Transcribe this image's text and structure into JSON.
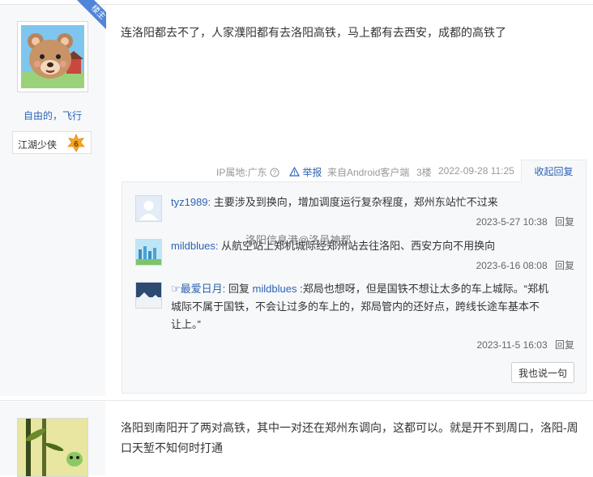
{
  "floor_post": {
    "corner_badge": "楼主",
    "author": {
      "name": "自由的，飞行",
      "level_title": "江湖少侠",
      "level_number": "6"
    },
    "content": "连洛阳都去不了，人家濮阳都有去洛阳高铁，马上都有去西安，成都的高铁了",
    "meta": {
      "ip_location": "IP属地:广东",
      "report": "举报",
      "source": "来自Android客户端",
      "floor": "3楼",
      "time": "2022-09-28 11:25"
    },
    "collapse_reply_label": "收起回复"
  },
  "replies": [
    {
      "user": "tyz1989:",
      "text": "主要涉及到换向，增加调度运行复杂程度，郑州东站忙不过来",
      "time": "2023-5-27 10:38",
      "reply_label": "回复"
    },
    {
      "user": "mildblues:",
      "text": "从航空站上郑机城际经郑州站去往洛阳、西安方向不用换向",
      "time": "2023-6-16 08:08",
      "reply_label": "回复"
    },
    {
      "user": "☞最爱日月:",
      "reply_prefix": "回复",
      "reply_to": "mildblues",
      "text_line1": ":郑局也想呀，但是国铁不想让太多的车上城际。“郑机",
      "text_line2": "城际不属于国铁，不会让过多的车上的，郑局管内的还好点，跨线长途车基本不",
      "text_line3": "让上。”",
      "time": "2023-11-5 16:03",
      "reply_label": "回复"
    }
  ],
  "say_something_label": "我也说一句",
  "watermark": "洛阳信息港@洛邑神都",
  "next_post": {
    "content_line1": "洛阳到南阳开了两对高铁，其中一对还在郑州东调向，这都可以。就是开不到周口，洛阳-周",
    "content_line2": "口天堑不知何时打通"
  },
  "colors": {
    "link_blue": "#2d64b3",
    "side_bg": "#f7f8fa",
    "level_badge": "#f5a623"
  }
}
